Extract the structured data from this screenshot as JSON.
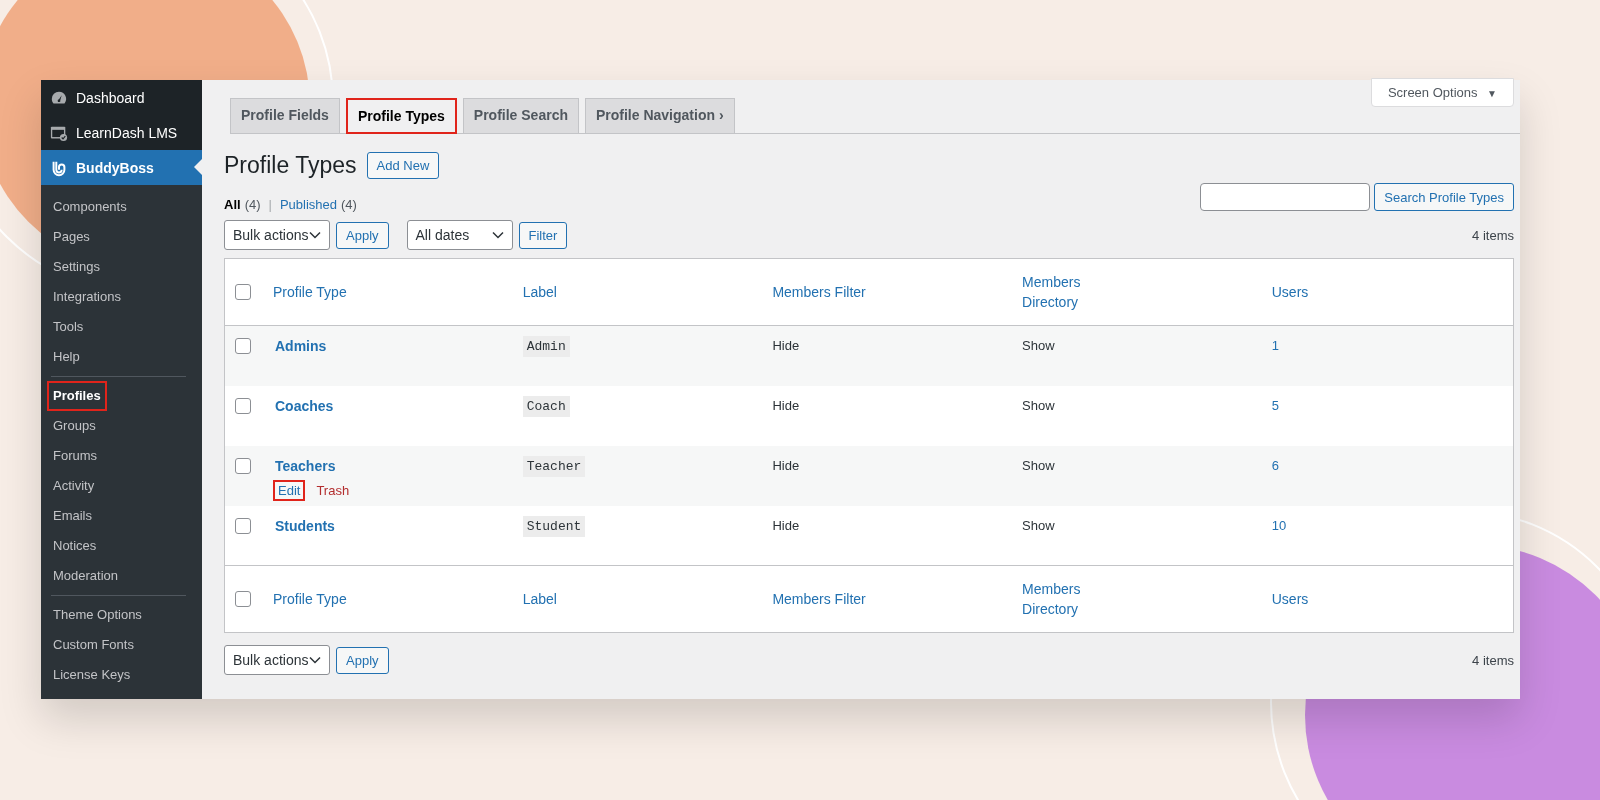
{
  "sidebar": {
    "top_items": [
      {
        "label": "Dashboard",
        "current": false
      },
      {
        "label": "LearnDash LMS",
        "current": false
      },
      {
        "label": "BuddyBoss",
        "current": true
      }
    ],
    "submenu_groups": [
      [
        {
          "label": "Components",
          "current": false,
          "highlighted": false
        },
        {
          "label": "Pages",
          "current": false,
          "highlighted": false
        },
        {
          "label": "Settings",
          "current": false,
          "highlighted": false
        },
        {
          "label": "Integrations",
          "current": false,
          "highlighted": false
        },
        {
          "label": "Tools",
          "current": false,
          "highlighted": false
        },
        {
          "label": "Help",
          "current": false,
          "highlighted": false
        }
      ],
      [
        {
          "label": "Profiles",
          "current": true,
          "highlighted": true
        },
        {
          "label": "Groups",
          "current": false,
          "highlighted": false
        },
        {
          "label": "Forums",
          "current": false,
          "highlighted": false
        },
        {
          "label": "Activity",
          "current": false,
          "highlighted": false
        },
        {
          "label": "Emails",
          "current": false,
          "highlighted": false
        },
        {
          "label": "Notices",
          "current": false,
          "highlighted": false
        },
        {
          "label": "Moderation",
          "current": false,
          "highlighted": false
        }
      ],
      [
        {
          "label": "Theme Options",
          "current": false,
          "highlighted": false
        },
        {
          "label": "Custom Fonts",
          "current": false,
          "highlighted": false
        },
        {
          "label": "License Keys",
          "current": false,
          "highlighted": false
        }
      ]
    ]
  },
  "screen_options": {
    "label": "Screen Options",
    "caret": "▼"
  },
  "tabs": [
    {
      "label": "Profile Fields",
      "selected": false,
      "highlighted": false
    },
    {
      "label": "Profile Types",
      "selected": true,
      "highlighted": true
    },
    {
      "label": "Profile Search",
      "selected": false,
      "highlighted": false
    },
    {
      "label": "Profile Navigation ›",
      "selected": false,
      "highlighted": false
    }
  ],
  "page_title": "Profile Types",
  "add_new": "Add New",
  "views": [
    {
      "label": "All",
      "count": "(4)",
      "selected": true
    },
    {
      "separator": "|",
      "label": "Published",
      "count": "(4)",
      "selected": false
    }
  ],
  "search_button": "Search Profile Types",
  "top_controls": {
    "bulk_actions": "Bulk actions",
    "apply": "Apply",
    "dates": "All dates",
    "filter": "Filter",
    "items_count": "4 items"
  },
  "table": {
    "select_all_checked": false,
    "footer_select_all_checked": false,
    "columns": [
      "Profile Type",
      "Label",
      "Members Filter",
      "Members\nDirectory",
      "Users"
    ],
    "rows": [
      {
        "name": "Admins",
        "label": "Admin",
        "members_filter": "Hide",
        "members_directory": "Show",
        "users": "1",
        "checked": false,
        "actions": []
      },
      {
        "name": "Coaches",
        "label": "Coach",
        "members_filter": "Hide",
        "members_directory": "Show",
        "users": "5",
        "checked": false,
        "actions": []
      },
      {
        "name": "Teachers",
        "label": "Teacher",
        "members_filter": "Hide",
        "members_directory": "Show",
        "users": "6",
        "checked": false,
        "actions": [
          {
            "label": "Edit",
            "kind": "edit",
            "highlighted": true
          },
          {
            "label": "Trash",
            "kind": "trash",
            "highlighted": false
          }
        ]
      },
      {
        "name": "Students",
        "label": "Student",
        "members_filter": "Hide",
        "members_directory": "Show",
        "users": "10",
        "checked": false,
        "actions": []
      }
    ],
    "footer_columns": [
      "Profile Type",
      "Label",
      "Members Filter",
      "Members\nDirectory",
      "Users"
    ]
  },
  "bottom_controls": {
    "bulk_actions": "Bulk actions",
    "apply": "Apply",
    "items_count": "4 items"
  }
}
